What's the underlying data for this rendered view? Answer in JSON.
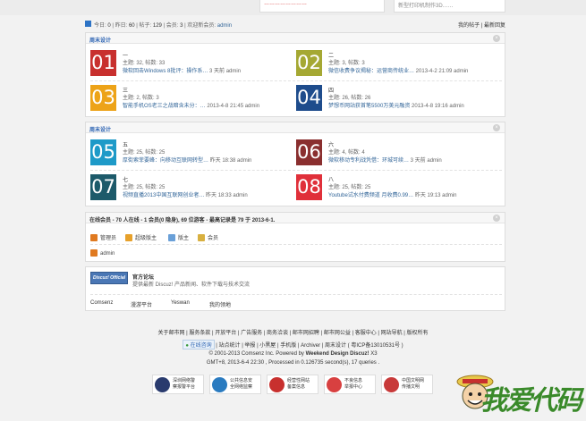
{
  "top": {
    "card1": "……………………",
    "card2": "新型打印机制作3D……"
  },
  "stats": {
    "today_label": "今日:",
    "today": "0",
    "yesterday_label": "昨日:",
    "yesterday": "60",
    "posts_label": "帖子:",
    "posts": "129",
    "members_label": "会员:",
    "members": "3",
    "welcome_label": "欢迎新会员:",
    "welcome_user": "admin",
    "my_posts": "我的帖子",
    "latest_reply": "最新回复"
  },
  "panel1": {
    "title": "周末设计",
    "close": "×",
    "forums": [
      {
        "num": "01",
        "color": "#c8302e",
        "name": "一",
        "counts": "主题: 32, 帖数: 33",
        "last_link": "微软回击Windows 8批评：操作系…",
        "last_meta": " 3 天前 admin"
      },
      {
        "num": "02",
        "color": "#a5a833",
        "name": "二",
        "counts": "主题: 3, 帖数: 3",
        "last_link": "微信收费争议揭秘：运营商传统业…",
        "last_meta": " 2013-4-2 21:09 admin"
      },
      {
        "num": "03",
        "color": "#eda318",
        "name": "三",
        "counts": "主题: 2, 帖数: 3",
        "last_link": "智能手机OS老三之战暗含未分：…",
        "last_meta": " 2013-4-8 21:45 admin"
      },
      {
        "num": "04",
        "color": "#1e4c8c",
        "name": "四",
        "counts": "主题: 26, 帖数: 26",
        "last_link": "梦想币网站获首笔5500万美元融资",
        "last_meta": " 2013-4-8 19:16 admin"
      }
    ]
  },
  "panel2": {
    "title": "周末设计",
    "close": "×",
    "forums": [
      {
        "num": "05",
        "color": "#1e9ac8",
        "name": "五",
        "counts": "主题: 25, 帖数: 25",
        "last_link": "厚街索菲要峰：向移动互联网转型…",
        "last_meta": " 昨天 18:38 admin"
      },
      {
        "num": "06",
        "color": "#8a2f2f",
        "name": "六",
        "counts": "主题: 4, 帖数: 4",
        "last_link": "微软移动专利战凭借：环城可续…",
        "last_meta": " 3 天前 admin"
      },
      {
        "num": "07",
        "color": "#1d5a6a",
        "name": "七",
        "counts": "主题: 25, 帖数: 25",
        "last_link": "视频直播2013中国互联网创业者…",
        "last_meta": " 昨天 18:33 admin"
      },
      {
        "num": "08",
        "color": "#e0303a",
        "name": "八",
        "counts": "主题: 25, 帖数: 25",
        "last_link": "Youtube试水付费频道 月收费0.99…",
        "last_meta": " 昨天 19:13 admin"
      }
    ]
  },
  "online": {
    "title": "在线会员 - 70 人在线 - 1 会员(0 隐身), 69 位游客 - 最高记录是 79 于 2013-6-1.",
    "close": "×",
    "legend": [
      {
        "label": "管理员",
        "color": "#e07a20"
      },
      {
        "label": "超级版主",
        "color": "#e7a12b"
      },
      {
        "label": "版主",
        "color": "#6aa0d8"
      },
      {
        "label": "会员",
        "color": "#d8b040"
      }
    ],
    "user": "admin",
    "user_color": "#e07a20"
  },
  "links": {
    "logo": "Discuz! Official",
    "name": "官方论坛",
    "desc": "提供最新 Discuz! 产品新闻、软件下载与技术交流",
    "friends": [
      "Comsenz",
      "漫游平台",
      "Yeswan",
      "我的领地"
    ]
  },
  "footer": {
    "line1": "关于邮市网 | 服务条款 | 开放平台 | 广告服务 | 商务洽谈 | 邮市网招聘 | 邮市网公益 | 客服中心 | 网站导航 | 版权所有",
    "online_service": "在线咨询",
    "line2": "| 站点统计 | 举报 | 小黑屋 | 手机版 | Archiver | 周末设计 ( 粤ICP备13010531号 )",
    "line3_pre": "© 2001-2013 Comsenz Inc.   Powered by ",
    "line3_brand": "Weekend Design Discuz!",
    "line3_post": " X3",
    "line4": "GMT+8, 2013-6-4 22:30 , Processed in 0.126735 second(s), 17 queries .",
    "badges": [
      {
        "text": "深圳网络警\n察报警平台",
        "color": "#2a3b6e"
      },
      {
        "text": "公共信息安\n全网络监察",
        "color": "#2a7bc0"
      },
      {
        "text": "经营性网站\n备案信息",
        "color": "#c8302e"
      },
      {
        "text": "不良信息\n举报中心",
        "color": "#d84040"
      },
      {
        "text": "中国文明网\n传播文明",
        "color": "#c83a3a"
      }
    ]
  },
  "watermark": {
    "text": "我爱代码"
  }
}
